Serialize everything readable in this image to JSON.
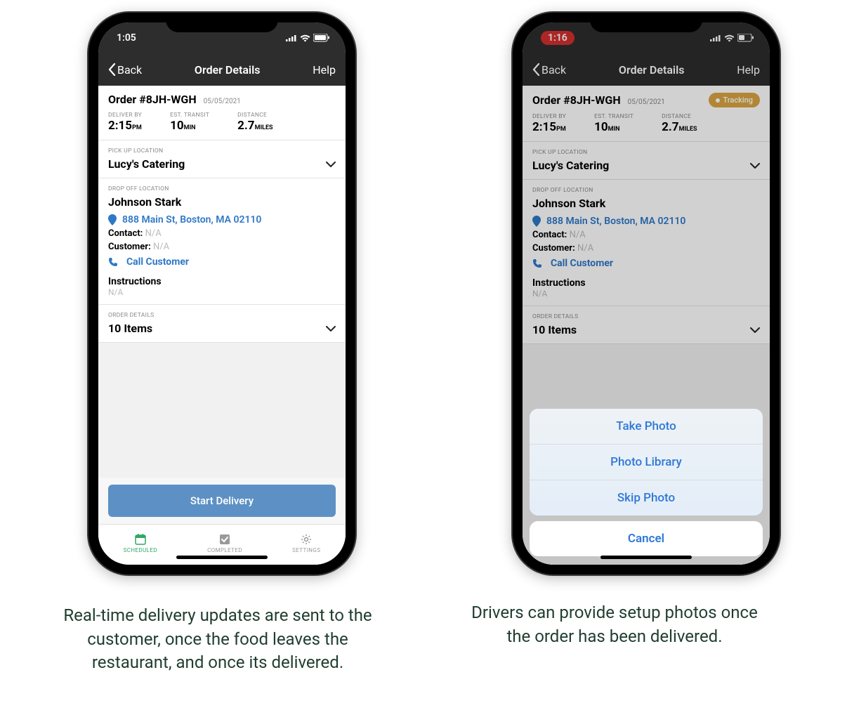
{
  "captions": {
    "left": "Real-time delivery updates are sent to the customer, once the food leaves the restaurant, and once its delivered.",
    "right": "Drivers can provide setup photos once the order has been delivered."
  },
  "phone1": {
    "status": {
      "time": "1:05"
    },
    "nav": {
      "back": "Back",
      "title": "Order Details",
      "help": "Help"
    },
    "order": {
      "number": "Order #8JH-WGH",
      "date": "05/05/2021"
    },
    "metrics": {
      "deliver_label": "DELIVER BY",
      "deliver_value": "2:15",
      "deliver_unit": "PM",
      "transit_label": "EST. TRANSIT",
      "transit_value": "10",
      "transit_unit": "MIN",
      "distance_label": "DISTANCE",
      "distance_value": "2.7",
      "distance_unit": "MILES"
    },
    "pickup": {
      "label": "PICK UP LOCATION",
      "name": "Lucy's Catering"
    },
    "dropoff": {
      "label": "DROP OFF LOCATION",
      "name": "Johnson Stark",
      "address": "888 Main St, Boston, MA 02110",
      "contact_label": "Contact:",
      "contact_value": "N/A",
      "customer_label": "Customer:",
      "customer_value": "N/A",
      "call": "Call Customer",
      "instructions_label": "Instructions",
      "instructions_value": "N/A"
    },
    "details": {
      "label": "ORDER DETAILS",
      "items": "10 Items"
    },
    "cta": "Start Delivery",
    "tabs": {
      "scheduled": "SCHEDULED",
      "completed": "COMPLETED",
      "settings": "SETTINGS"
    }
  },
  "phone2": {
    "status": {
      "time": "1:16"
    },
    "nav": {
      "back": "Back",
      "title": "Order Details",
      "help": "Help"
    },
    "order": {
      "number": "Order #8JH-WGH",
      "date": "05/05/2021",
      "tracking": "Tracking"
    },
    "metrics": {
      "deliver_label": "DELIVER BY",
      "deliver_value": "2:15",
      "deliver_unit": "PM",
      "transit_label": "EST. TRANSIT",
      "transit_value": "10",
      "transit_unit": "MIN",
      "distance_label": "DISTANCE",
      "distance_value": "2.7",
      "distance_unit": "MILES"
    },
    "pickup": {
      "label": "PICK UP LOCATION",
      "name": "Lucy's Catering"
    },
    "dropoff": {
      "label": "DROP OFF LOCATION",
      "name": "Johnson Stark",
      "address": "888 Main St, Boston, MA 02110",
      "contact_label": "Contact:",
      "contact_value": "N/A",
      "customer_label": "Customer:",
      "customer_value": "N/A",
      "call": "Call Customer",
      "instructions_label": "Instructions",
      "instructions_value": "N/A"
    },
    "details": {
      "label": "ORDER DETAILS",
      "items": "10 Items"
    },
    "sheet": {
      "take_photo": "Take Photo",
      "photo_library": "Photo Library",
      "skip_photo": "Skip Photo",
      "cancel": "Cancel"
    }
  }
}
